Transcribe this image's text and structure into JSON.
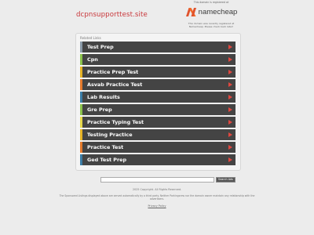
{
  "site": {
    "title": "dcpnsupporttest.site"
  },
  "registrar": {
    "top_text": "This domain is registered at",
    "logo_text": "namecheap",
    "note": "This domain was recently registered at Namecheap. Please check back later!"
  },
  "related": {
    "heading": "Related Links",
    "links": [
      {
        "label": "Test Prep",
        "color": "#8a9aa8"
      },
      {
        "label": "Cpn",
        "color": "#8bc34a"
      },
      {
        "label": "Practice Prep Test",
        "color": "#e6b325"
      },
      {
        "label": "Asvab Practice Test",
        "color": "#e57a2b"
      },
      {
        "label": "Lab Results",
        "color": "#3a7ca5"
      },
      {
        "label": "Gre Prep",
        "color": "#8bc34a"
      },
      {
        "label": "Practice Typing Test",
        "color": "#e6d84a"
      },
      {
        "label": "Testing Practice",
        "color": "#e6b325"
      },
      {
        "label": "Practice Test",
        "color": "#e57a2b"
      },
      {
        "label": "Ged Test Prep",
        "color": "#3a7ca5"
      }
    ]
  },
  "search": {
    "placeholder": "",
    "button": "Search Ads"
  },
  "footer": {
    "copyright": "2025 Copyright. All Rights Reserved.",
    "disclaimer": "The Sponsored Listings displayed above are served automatically by a third party. Neither Parkingcrew nor the domain owner maintain any relationship with the advertisers.",
    "privacy": "Privacy Policy"
  },
  "colors": {
    "title": "#c8363a",
    "row_bg": "#444444",
    "arrow": "#e1473f"
  }
}
